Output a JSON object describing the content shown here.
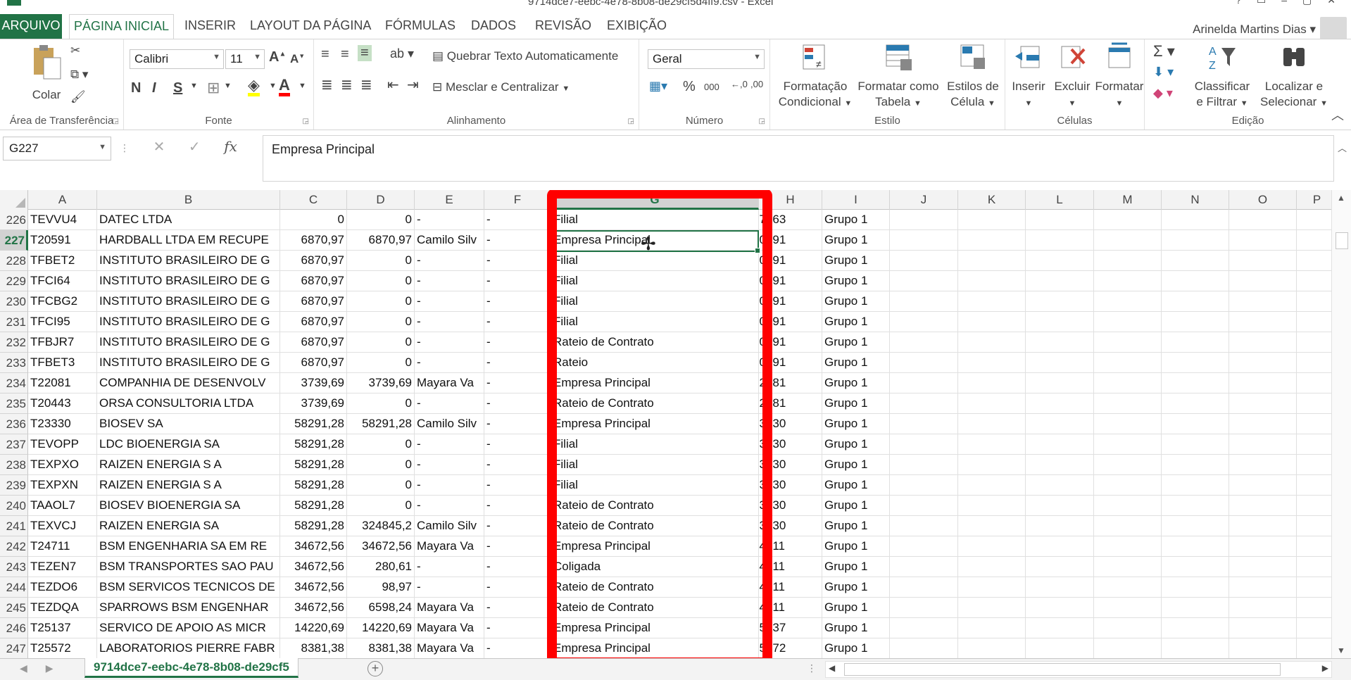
{
  "window": {
    "title": "9714dce7-eebc-4e78-8b08-de29cf5d4ff9.csv - Excel"
  },
  "menu": {
    "tabs": [
      "ARQUIVO",
      "PÁGINA INICIAL",
      "INSERIR",
      "LAYOUT DA PÁGINA",
      "FÓRMULAS",
      "DADOS",
      "REVISÃO",
      "EXIBIÇÃO"
    ],
    "user": "Arinelda Martins Dias"
  },
  "ribbon": {
    "clipboard": {
      "paste": "Colar",
      "label": "Área de Transferência"
    },
    "font": {
      "name": "Calibri",
      "size": "11",
      "label": "Fonte",
      "bold": "N",
      "italic": "I",
      "underline": "S"
    },
    "alignment": {
      "wrap": "Quebrar Texto Automaticamente",
      "merge": "Mesclar e Centralizar",
      "label": "Alinhamento"
    },
    "number": {
      "format": "Geral",
      "percent": "%",
      "thousands": "000",
      "label": "Número"
    },
    "styles": {
      "conditional": [
        "Formatação",
        "Condicional"
      ],
      "table": [
        "Formatar como",
        "Tabela"
      ],
      "cell": [
        "Estilos de",
        "Célula"
      ],
      "label": "Estilo"
    },
    "cells": {
      "insert": "Inserir",
      "delete": "Excluir",
      "format": "Formatar",
      "label": "Células"
    },
    "editing": {
      "sort": [
        "Classificar",
        "e Filtrar"
      ],
      "find": [
        "Localizar e",
        "Selecionar"
      ],
      "label": "Edição"
    }
  },
  "formula_bar": {
    "name_box": "G227",
    "value": "Empresa Principal",
    "fx": "fx"
  },
  "columns": [
    "A",
    "B",
    "C",
    "D",
    "E",
    "F",
    "G",
    "H",
    "I",
    "J",
    "K",
    "L",
    "M",
    "N",
    "O",
    "P"
  ],
  "rows": [
    {
      "n": "226",
      "A": "TEVVU4",
      "B": "DATEC LTDA",
      "C": "0",
      "D": "0",
      "E": "-",
      "F": "-",
      "G": "Filial",
      "H": "17263",
      "I": "Grupo 1"
    },
    {
      "n": "227",
      "A": "T20591",
      "B": "HARDBALL LTDA EM RECUPE",
      "C": "6870,97",
      "D": "6870,97",
      "E": "Camilo Silv",
      "F": "-",
      "G": "Empresa Principal",
      "H": "20591",
      "I": "Grupo 1"
    },
    {
      "n": "228",
      "A": "TFBET2",
      "B": "INSTITUTO BRASILEIRO DE G",
      "C": "6870,97",
      "D": "0",
      "E": "-",
      "F": "-",
      "G": "Filial",
      "H": "20591",
      "I": "Grupo 1"
    },
    {
      "n": "229",
      "A": "TFCI64",
      "B": "INSTITUTO BRASILEIRO DE G",
      "C": "6870,97",
      "D": "0",
      "E": "-",
      "F": "-",
      "G": "Filial",
      "H": "20591",
      "I": "Grupo 1"
    },
    {
      "n": "230",
      "A": "TFCBG2",
      "B": "INSTITUTO BRASILEIRO DE G",
      "C": "6870,97",
      "D": "0",
      "E": "-",
      "F": "-",
      "G": "Filial",
      "H": "20591",
      "I": "Grupo 1"
    },
    {
      "n": "231",
      "A": "TFCI95",
      "B": "INSTITUTO BRASILEIRO DE G",
      "C": "6870,97",
      "D": "0",
      "E": "-",
      "F": "-",
      "G": "Filial",
      "H": "20591",
      "I": "Grupo 1"
    },
    {
      "n": "232",
      "A": "TFBJR7",
      "B": "INSTITUTO BRASILEIRO DE G",
      "C": "6870,97",
      "D": "0",
      "E": "-",
      "F": "-",
      "G": "Rateio de Contrato",
      "H": "20591",
      "I": "Grupo 1"
    },
    {
      "n": "233",
      "A": "TFBET3",
      "B": "INSTITUTO BRASILEIRO DE G",
      "C": "6870,97",
      "D": "0",
      "E": "-",
      "F": "-",
      "G": "Rateio",
      "H": "20591",
      "I": "Grupo 1"
    },
    {
      "n": "234",
      "A": "T22081",
      "B": "COMPANHIA DE DESENVOLV",
      "C": "3739,69",
      "D": "3739,69",
      "E": "Mayara Va",
      "F": "-",
      "G": "Empresa Principal",
      "H": "22081",
      "I": "Grupo 1"
    },
    {
      "n": "235",
      "A": "T20443",
      "B": "ORSA CONSULTORIA LTDA",
      "C": "3739,69",
      "D": "0",
      "E": "-",
      "F": "-",
      "G": "Rateio de Contrato",
      "H": "22081",
      "I": "Grupo 1"
    },
    {
      "n": "236",
      "A": "T23330",
      "B": "BIOSEV SA",
      "C": "58291,28",
      "D": "58291,28",
      "E": "Camilo Silv",
      "F": "-",
      "G": "Empresa Principal",
      "H": "23330",
      "I": "Grupo 1"
    },
    {
      "n": "237",
      "A": "TEVOPP",
      "B": "LDC BIOENERGIA SA",
      "C": "58291,28",
      "D": "0",
      "E": "-",
      "F": "-",
      "G": "Filial",
      "H": "23330",
      "I": "Grupo 1"
    },
    {
      "n": "238",
      "A": "TEXPXO",
      "B": "RAIZEN ENERGIA S A",
      "C": "58291,28",
      "D": "0",
      "E": "-",
      "F": "-",
      "G": "Filial",
      "H": "23330",
      "I": "Grupo 1"
    },
    {
      "n": "239",
      "A": "TEXPXN",
      "B": "RAIZEN ENERGIA S A",
      "C": "58291,28",
      "D": "0",
      "E": "-",
      "F": "-",
      "G": "Filial",
      "H": "23330",
      "I": "Grupo 1"
    },
    {
      "n": "240",
      "A": "TAAOL7",
      "B": "BIOSEV BIOENERGIA SA",
      "C": "58291,28",
      "D": "0",
      "E": "-",
      "F": "-",
      "G": "Rateio de Contrato",
      "H": "23330",
      "I": "Grupo 1"
    },
    {
      "n": "241",
      "A": "TEXVCJ",
      "B": "RAIZEN ENERGIA SA",
      "C": "58291,28",
      "D": "324845,2",
      "E": "Camilo Silv",
      "F": "-",
      "G": "Rateio de Contrato",
      "H": "23330",
      "I": "Grupo 1"
    },
    {
      "n": "242",
      "A": "T24711",
      "B": "BSM ENGENHARIA SA EM RE",
      "C": "34672,56",
      "D": "34672,56",
      "E": "Mayara Va",
      "F": "-",
      "G": "Empresa Principal",
      "H": "24711",
      "I": "Grupo 1"
    },
    {
      "n": "243",
      "A": "TEZEN7",
      "B": "BSM TRANSPORTES SAO PAU",
      "C": "34672,56",
      "D": "280,61",
      "E": "-",
      "F": "-",
      "G": "Coligada",
      "H": "24711",
      "I": "Grupo 1"
    },
    {
      "n": "244",
      "A": "TEZDO6",
      "B": "BSM SERVICOS TECNICOS DE",
      "C": "34672,56",
      "D": "98,97",
      "E": "-",
      "F": "-",
      "G": "Rateio de Contrato",
      "H": "24711",
      "I": "Grupo 1"
    },
    {
      "n": "245",
      "A": "TEZDQA",
      "B": "SPARROWS BSM ENGENHAR",
      "C": "34672,56",
      "D": "6598,24",
      "E": "Mayara Va",
      "F": "-",
      "G": "Rateio de Contrato",
      "H": "24711",
      "I": "Grupo 1"
    },
    {
      "n": "246",
      "A": "T25137",
      "B": "SERVICO DE APOIO AS MICR",
      "C": "14220,69",
      "D": "14220,69",
      "E": "Mayara Va",
      "F": "-",
      "G": "Empresa Principal",
      "H": "25137",
      "I": "Grupo 1"
    },
    {
      "n": "247",
      "A": "T25572",
      "B": "LABORATORIOS PIERRE FABR",
      "C": "8381,38",
      "D": "8381,38",
      "E": "Mayara Va",
      "F": "-",
      "G": "Empresa Principal",
      "H": "25572",
      "I": "Grupo 1"
    }
  ],
  "selected": {
    "row": "227",
    "column": "G"
  },
  "sheet": {
    "tab": "9714dce7-eebc-4e78-8b08-de29cf5",
    "add": "+"
  },
  "colors": {
    "accent": "#217346",
    "highlight": "#ff0000"
  }
}
